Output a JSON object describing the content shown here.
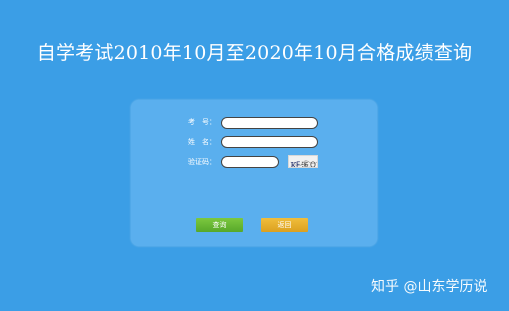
{
  "page": {
    "title": "自学考试2010年10月至2020年10月合格成绩查询"
  },
  "form": {
    "exam_number_label": "考　号：",
    "exam_number_value": "",
    "name_label": "姓　名：",
    "name_value": "",
    "captcha_label": "验证码：",
    "captcha_value": "",
    "captcha_image_text": "KF涉Q"
  },
  "buttons": {
    "query_label": "查询",
    "back_label": "返回"
  },
  "watermark": {
    "text": "知乎 @山东学历说"
  },
  "colors": {
    "background": "#3b9ee6",
    "panel": "#5aafee",
    "query_button": "#62b330",
    "back_button": "#e5ad2a"
  }
}
